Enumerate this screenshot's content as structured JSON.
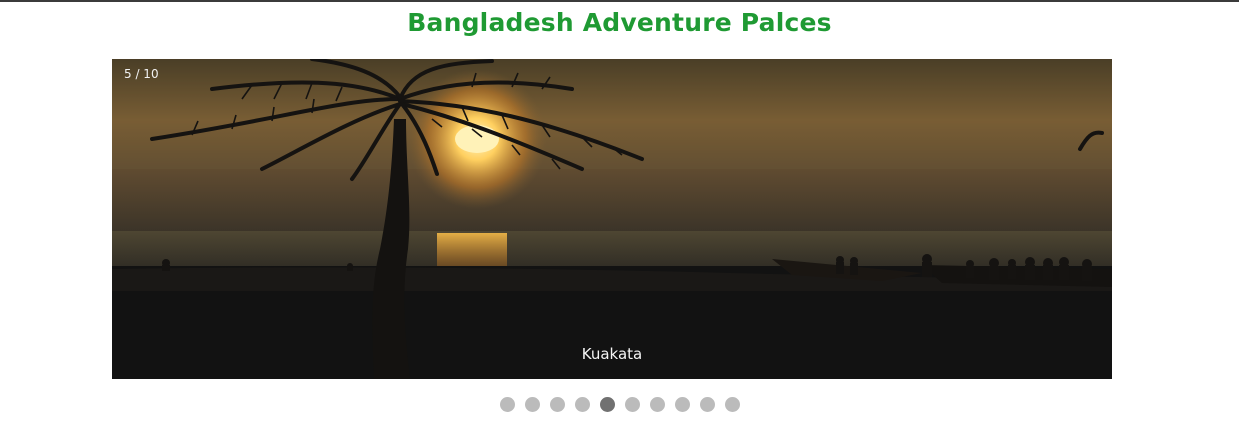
{
  "page": {
    "title": "Bangladesh Adventure Palces"
  },
  "slideshow": {
    "counter": "5 / 10",
    "caption": "Kuakata",
    "total_slides": 10,
    "active_index": 5,
    "image": "sunset-beach-palm-silhouette"
  },
  "colors": {
    "title": "#1f9a33",
    "dot": "#bbbbbb",
    "dot_active": "#717171"
  }
}
